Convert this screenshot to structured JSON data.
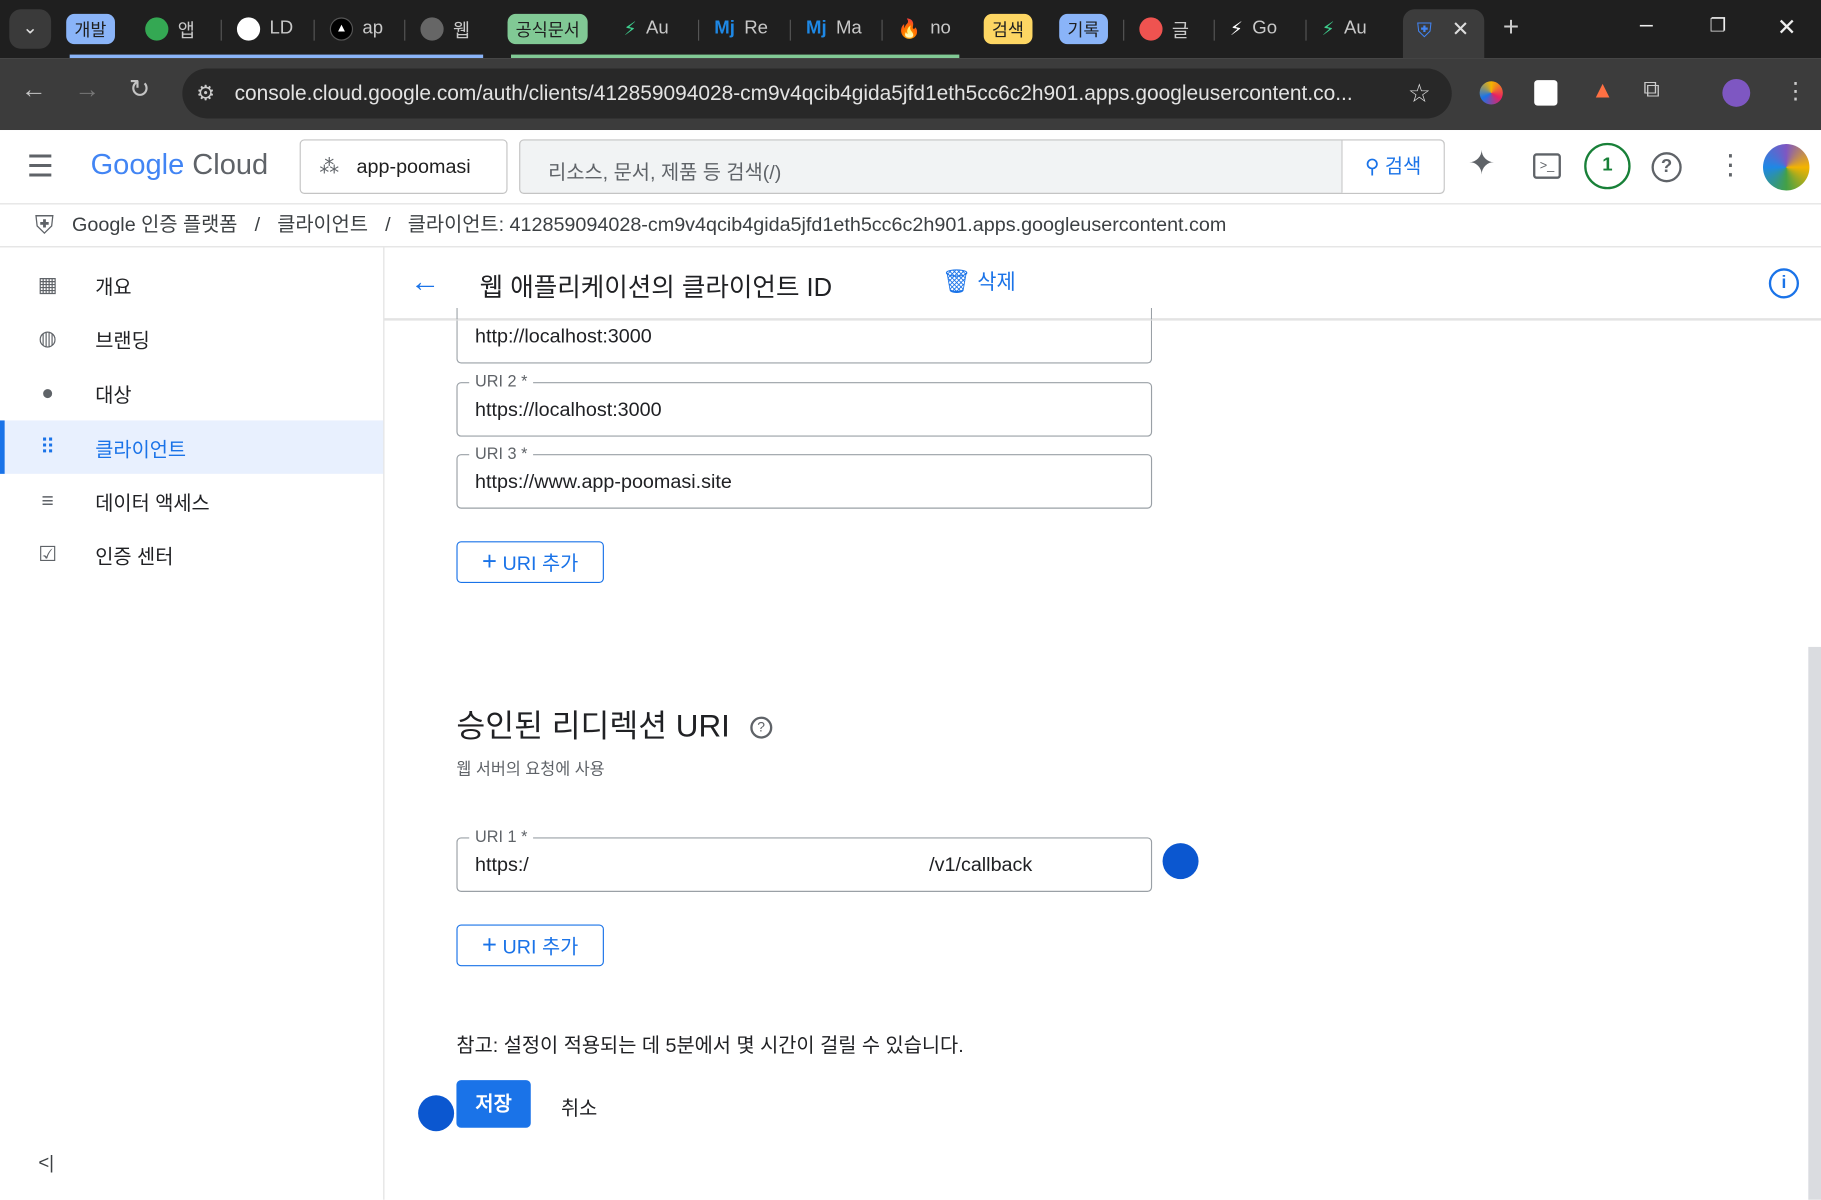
{
  "browser": {
    "tabs": [
      {
        "kind": "group",
        "label": "개발",
        "color": "#8ab4f8"
      },
      {
        "kind": "tab",
        "label": "앱",
        "icon": "green-dots-icon"
      },
      {
        "kind": "tab",
        "label": "LD",
        "icon": "github-icon"
      },
      {
        "kind": "tab",
        "label": "ap",
        "icon": "triangle-icon"
      },
      {
        "kind": "tab",
        "label": "웹",
        "icon": "square-icon"
      },
      {
        "kind": "group",
        "label": "공식문서",
        "color": "#81c995"
      },
      {
        "kind": "tab",
        "label": "Au",
        "icon": "bolt-icon"
      },
      {
        "kind": "tab",
        "label": "Re",
        "icon": "mj-icon"
      },
      {
        "kind": "tab",
        "label": "Ma",
        "icon": "mj-icon"
      },
      {
        "kind": "tab",
        "label": "no",
        "icon": "flame-icon"
      },
      {
        "kind": "group",
        "label": "검색",
        "color": "#fdd663"
      },
      {
        "kind": "group",
        "label": "기록",
        "color": "#8ab4f8"
      },
      {
        "kind": "tab",
        "label": "글",
        "icon": "red-dots-icon"
      },
      {
        "kind": "tab",
        "label": "Go",
        "icon": "bolt-icon"
      },
      {
        "kind": "tab",
        "label": "Au",
        "icon": "bolt-icon"
      }
    ],
    "url": "console.cloud.google.com/auth/clients/412859094028-cm9v4qcib4gida5jfd1eth5cc6c2h901.apps.googleusercontent.co..."
  },
  "header": {
    "logo_google": "Google",
    "logo_cloud": "Cloud",
    "project": "app-poomasi",
    "search_placeholder": "리소스, 문서, 제품 등 검색(/)",
    "search_button": "검색",
    "notification_count": "1"
  },
  "breadcrumb": [
    "Google 인증 플랫폼",
    "클라이언트",
    "클라이언트: 412859094028-cm9v4qcib4gida5jfd1eth5cc6c2h901.apps.googleusercontent.com"
  ],
  "sidebar": {
    "items": [
      {
        "label": "개요",
        "icon": "dashboard-icon"
      },
      {
        "label": "브랜딩",
        "icon": "palette-icon"
      },
      {
        "label": "대상",
        "icon": "person-icon"
      },
      {
        "label": "클라이언트",
        "icon": "grid-icon",
        "selected": true
      },
      {
        "label": "데이터 액세스",
        "icon": "settings-list-icon"
      },
      {
        "label": "인증 센터",
        "icon": "checkbox-icon"
      }
    ]
  },
  "main": {
    "title": "웹 애플리케이션의 클라이언트 ID",
    "delete": "삭제",
    "origins": [
      {
        "label": "",
        "value": "http://localhost:3000"
      },
      {
        "label": "URI 2 *",
        "value": "https://localhost:3000"
      },
      {
        "label": "URI 3 *",
        "value": "https://www.app-poomasi.site"
      }
    ],
    "add_uri": "URI 추가",
    "redirect_title": "승인된 리디렉션 URI",
    "redirect_sub": "웹 서버의 요청에 사용",
    "redirect": [
      {
        "label": "URI 1 *",
        "value_start": "https:/",
        "value_end": "/v1/callback"
      }
    ],
    "note": "참고: 설정이 적용되는 데 5분에서 몇 시간이 걸릴 수 있습니다.",
    "save": "저장",
    "cancel": "취소"
  }
}
